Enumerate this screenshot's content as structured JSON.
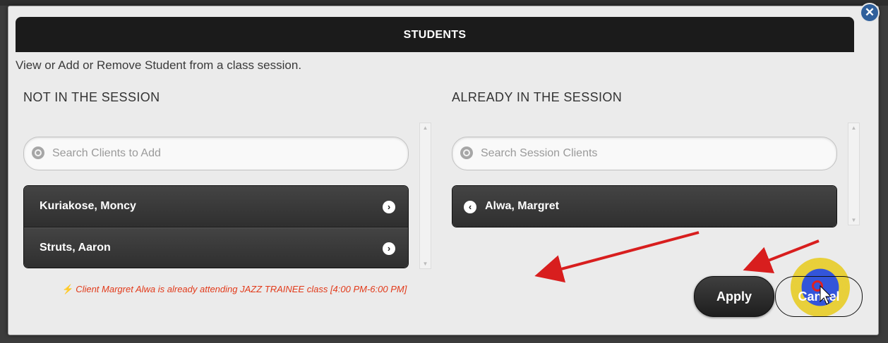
{
  "dialog": {
    "title": "STUDENTS",
    "description": "View or Add or Remove Student from a class session.",
    "close_icon": "close-icon"
  },
  "left": {
    "title": "NOT IN THE SESSION",
    "search_placeholder": "Search Clients to Add",
    "items": [
      {
        "label": "Kuriakose, Moncy"
      },
      {
        "label": "Struts, Aaron"
      }
    ]
  },
  "right": {
    "title": "ALREADY IN THE SESSION",
    "search_placeholder": "Search Session Clients",
    "items": [
      {
        "label": "Alwa, Margret"
      }
    ]
  },
  "warning": {
    "text": "Client Margret Alwa is already attending JAZZ TRAINEE class [4:00 PM-6:00 PM]",
    "icon": "lightning-icon"
  },
  "buttons": {
    "apply": "Apply",
    "cancel": "Cancel"
  },
  "colors": {
    "header_bg": "#1b1b1b",
    "warning_text": "#e23a1a",
    "annotation_arrow": "#d81e1e",
    "close_button": "#2f5f9b"
  }
}
